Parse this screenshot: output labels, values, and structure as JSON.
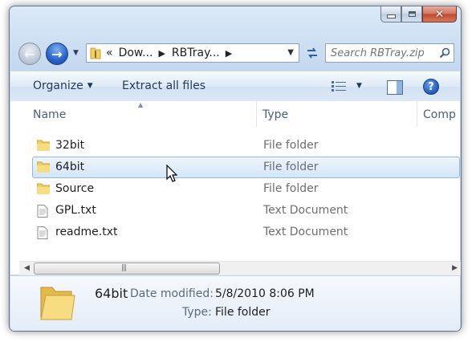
{
  "window": {
    "caption_buttons": {
      "minimize": "minimize",
      "maximize": "maximize",
      "close": "✕"
    }
  },
  "nav": {
    "back_glyph": "←",
    "forward_glyph": "→",
    "address": {
      "overflow": "«",
      "segments": [
        "Dow...",
        "RBTray..."
      ],
      "separator": "▶"
    },
    "search": {
      "placeholder": "Search RBTray.zip"
    }
  },
  "toolbar": {
    "organize_label": "Organize",
    "extract_label": "Extract all files",
    "caret": "▼",
    "help_label": "?"
  },
  "list": {
    "columns": {
      "name": "Name",
      "type": "Type",
      "comp": "Comp"
    },
    "rows": [
      {
        "name": "32bit",
        "type": "File folder",
        "icon": "folder-icon",
        "selected": false
      },
      {
        "name": "64bit",
        "type": "File folder",
        "icon": "folder-icon",
        "selected": true
      },
      {
        "name": "Source",
        "type": "File folder",
        "icon": "folder-icon",
        "selected": false
      },
      {
        "name": "GPL.txt",
        "type": "Text Document",
        "icon": "text-file-icon",
        "selected": false
      },
      {
        "name": "readme.txt",
        "type": "Text Document",
        "icon": "text-file-icon",
        "selected": false
      }
    ]
  },
  "scrollbar": {
    "left": "◀",
    "right": "▶",
    "grip": "|||"
  },
  "details": {
    "name": "64bit",
    "modified_label": "Date modified:",
    "modified_value": "5/8/2010 8:06 PM",
    "type_label": "Type:",
    "type_value": "File folder"
  },
  "colors": {
    "accent": "#1e395b",
    "selection": "#d3e6fb",
    "folder": "#f2cf62"
  }
}
